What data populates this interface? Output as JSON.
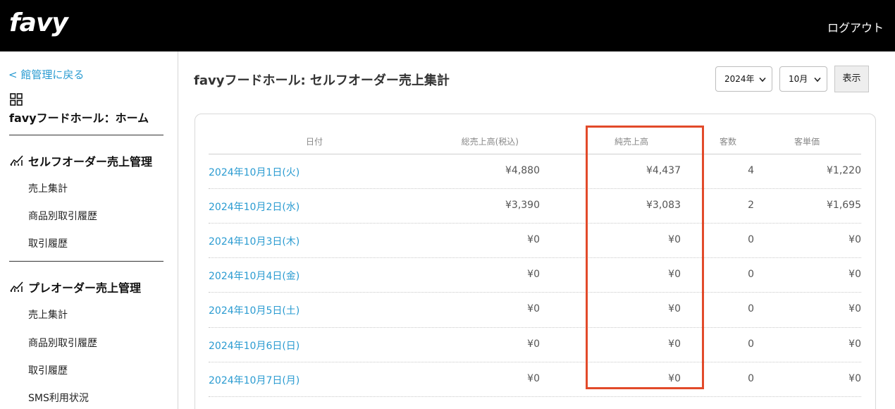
{
  "header": {
    "logo": "favy",
    "logout": "ログアウト"
  },
  "sidebar": {
    "back": "< 館管理に戻る",
    "home": "favyフードホール：ホーム",
    "sections": [
      {
        "title": "セルフオーダー売上管理",
        "items": [
          "売上集計",
          "商品別取引履歴",
          "取引履歴"
        ]
      },
      {
        "title": "プレオーダー売上管理",
        "items": [
          "売上集計",
          "商品別取引履歴",
          "取引履歴",
          "SMS利用状況"
        ]
      }
    ]
  },
  "page": {
    "title": "favyフードホール: セルフオーダー売上集計"
  },
  "filters": {
    "year": "2024年",
    "month": "10月",
    "show": "表示"
  },
  "table": {
    "headers": [
      "日付",
      "総売上高(税込)",
      "純売上高",
      "客数",
      "客単価"
    ],
    "rows": [
      [
        "2024年10月1日(火)",
        "¥4,880",
        "¥4,437",
        "4",
        "¥1,220"
      ],
      [
        "2024年10月2日(水)",
        "¥3,390",
        "¥3,083",
        "2",
        "¥1,695"
      ],
      [
        "2024年10月3日(木)",
        "¥0",
        "¥0",
        "0",
        "¥0"
      ],
      [
        "2024年10月4日(金)",
        "¥0",
        "¥0",
        "0",
        "¥0"
      ],
      [
        "2024年10月5日(土)",
        "¥0",
        "¥0",
        "0",
        "¥0"
      ],
      [
        "2024年10月6日(日)",
        "¥0",
        "¥0",
        "0",
        "¥0"
      ],
      [
        "2024年10月7日(月)",
        "¥0",
        "¥0",
        "0",
        "¥0"
      ]
    ]
  },
  "colors": {
    "accent": "#2a9bd1",
    "highlight": "#e24a2a",
    "topbar": "#000000"
  }
}
